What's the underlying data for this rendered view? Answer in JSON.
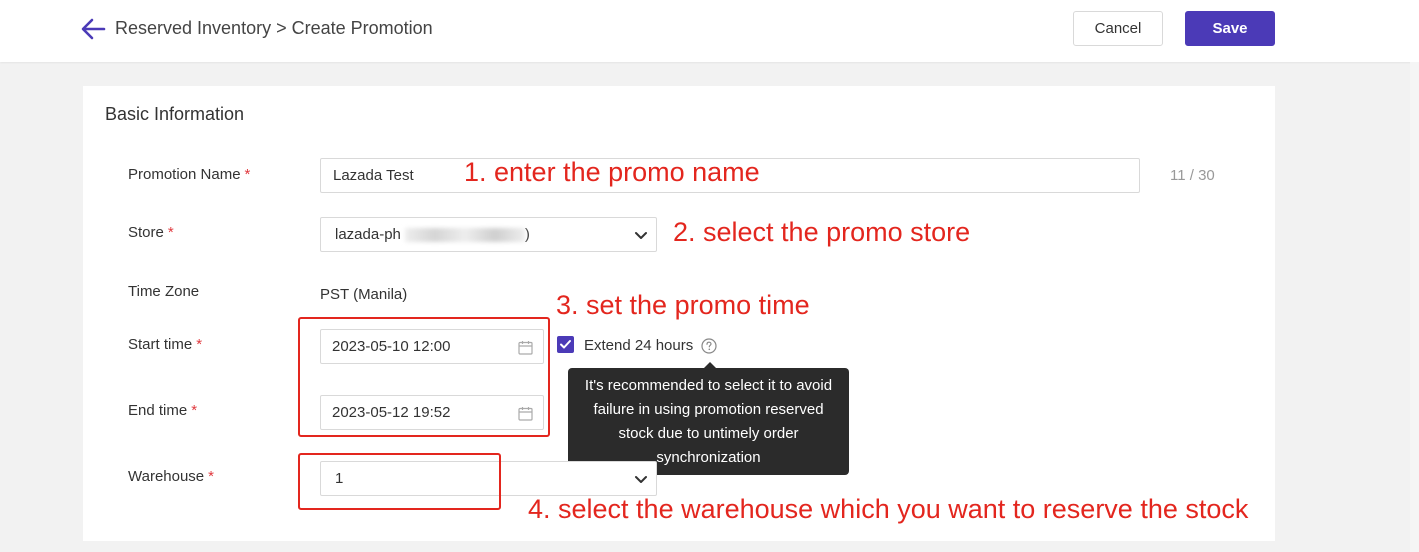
{
  "header": {
    "breadcrumb": "Reserved Inventory > Create Promotion",
    "cancel_label": "Cancel",
    "save_label": "Save"
  },
  "form": {
    "section_title": "Basic Information",
    "required_mark": "*",
    "promotion_name": {
      "label": "Promotion Name",
      "value": "Lazada Test",
      "counter": "11 / 30"
    },
    "store": {
      "label": "Store",
      "value_prefix": "lazada-ph",
      "value_suffix": ")"
    },
    "time_zone": {
      "label": "Time Zone",
      "value": "PST (Manila)"
    },
    "start_time": {
      "label": "Start time",
      "value": "2023-05-10 12:00"
    },
    "end_time": {
      "label": "End time",
      "value": "2023-05-12 19:52"
    },
    "extend": {
      "label": "Extend 24 hours",
      "checked": true
    },
    "tooltip": "It's recommended to select it to avoid failure in using promotion reserved stock due to untimely order synchronization",
    "warehouse": {
      "label": "Warehouse",
      "value": "1"
    }
  },
  "annotations": {
    "step1": "1. enter the promo name",
    "step2": "2. select the promo store",
    "step3": "3. set the promo time",
    "step4": "4. select the warehouse which you want to reserve the stock"
  },
  "colors": {
    "accent": "#4b3ab7",
    "required": "#e0393e",
    "annotation": "#e3261e",
    "tooltip_bg": "#2b2b2b"
  }
}
